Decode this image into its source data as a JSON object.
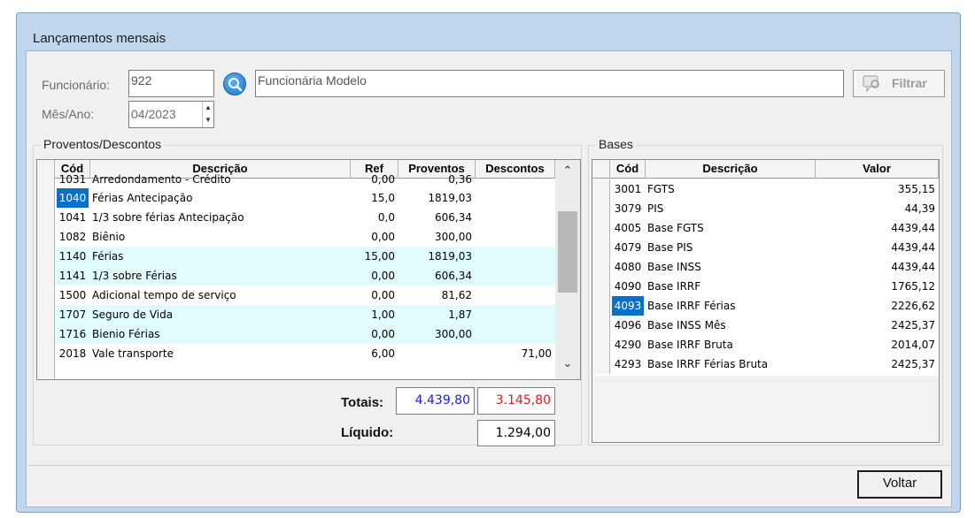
{
  "window": {
    "title": "Lançamentos mensais"
  },
  "form": {
    "employee_label": "Funcionário:",
    "employee_code": "922",
    "employee_name": "Funcionária Modelo",
    "month_label": "Mês/Ano:",
    "month_value": "04/2023",
    "filter_label": "Filtrar"
  },
  "proventos": {
    "title": "Proventos/Descontos",
    "columns": [
      "Cód",
      "Descrição",
      "Ref",
      "Proventos",
      "Descontos"
    ],
    "rows": [
      {
        "cod": "1031",
        "desc": "Arredondamento - Crédito",
        "ref": "0,00",
        "prov": "0,36",
        "desc_val": ""
      },
      {
        "cod": "1040",
        "desc": "Férias Antecipação",
        "ref": "15,0",
        "prov": "1819,03",
        "desc_val": ""
      },
      {
        "cod": "1041",
        "desc": "1/3 sobre férias Antecipação",
        "ref": "0,0",
        "prov": "606,34",
        "desc_val": ""
      },
      {
        "cod": "1082",
        "desc": "Biênio",
        "ref": "0,00",
        "prov": "300,00",
        "desc_val": ""
      },
      {
        "cod": "1140",
        "desc": "Férias",
        "ref": "15,00",
        "prov": "1819,03",
        "desc_val": ""
      },
      {
        "cod": "1141",
        "desc": "1/3 sobre Férias",
        "ref": "0,00",
        "prov": "606,34",
        "desc_val": ""
      },
      {
        "cod": "1500",
        "desc": "Adicional tempo de serviço",
        "ref": "0,00",
        "prov": "81,62",
        "desc_val": ""
      },
      {
        "cod": "1707",
        "desc": "Seguro de Vida",
        "ref": "1,00",
        "prov": "1,87",
        "desc_val": ""
      },
      {
        "cod": "1716",
        "desc": "Bienio Férias",
        "ref": "0,00",
        "prov": "300,00",
        "desc_val": ""
      },
      {
        "cod": "2018",
        "desc": "Vale transporte",
        "ref": "6,00",
        "prov": "",
        "desc_val": "71,00"
      }
    ],
    "totals_label": "Totais:",
    "total_proventos": "4.439,80",
    "total_descontos": "3.145,80",
    "liquido_label": "Líquido:",
    "liquido_value": "1.294,00"
  },
  "bases": {
    "title": "Bases",
    "columns": [
      "Cód",
      "Descrição",
      "Valor"
    ],
    "rows": [
      {
        "cod": "3001",
        "desc": "FGTS",
        "valor": "355,15"
      },
      {
        "cod": "3079",
        "desc": "PIS",
        "valor": "44,39"
      },
      {
        "cod": "4005",
        "desc": "Base FGTS",
        "valor": "4439,44"
      },
      {
        "cod": "4079",
        "desc": "Base PIS",
        "valor": "4439,44"
      },
      {
        "cod": "4080",
        "desc": "Base INSS",
        "valor": "4439,44"
      },
      {
        "cod": "4090",
        "desc": "Base IRRF",
        "valor": "1765,12"
      },
      {
        "cod": "4093",
        "desc": "Base IRRF Férias",
        "valor": "2226,62"
      },
      {
        "cod": "4096",
        "desc": "Base INSS Mês",
        "valor": "2425,37"
      },
      {
        "cod": "4290",
        "desc": "Base IRRF Bruta",
        "valor": "2014,07"
      },
      {
        "cod": "4293",
        "desc": "Base IRRF Férias Bruta",
        "valor": "2425,37"
      }
    ]
  },
  "footer": {
    "back_label": "Voltar"
  },
  "colors": {
    "total_proventos": "#1a1af0",
    "total_descontos": "#e01818",
    "selected_cell": "#0a6fc6",
    "alt_row": "#e1fcfc"
  }
}
